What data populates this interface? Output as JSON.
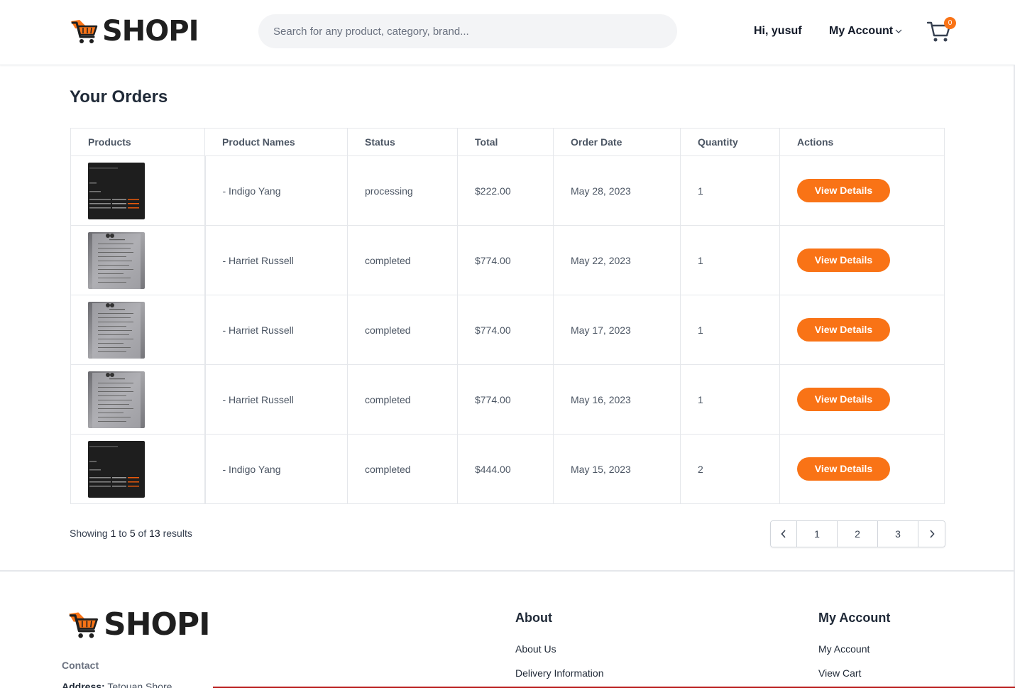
{
  "header": {
    "logo_text": "SHOPI",
    "search_placeholder": "Search for any product, category, brand...",
    "greeting": "Hi, yusuf",
    "account_label": "My Account",
    "cart_count": "0"
  },
  "page": {
    "title": "Your Orders"
  },
  "table": {
    "headers": [
      "Products",
      "Product Names",
      "Status",
      "Total",
      "Order Date",
      "Quantity",
      "Actions"
    ],
    "rows": [
      {
        "thumb": "code-screenshot",
        "name": "- Indigo Yang",
        "status": "processing",
        "total": "$222.00",
        "date": "May 28, 2023",
        "quantity": "1",
        "action": "View Details"
      },
      {
        "thumb": "paper-photo",
        "name": "- Harriet Russell",
        "status": "completed",
        "total": "$774.00",
        "date": "May 22, 2023",
        "quantity": "1",
        "action": "View Details"
      },
      {
        "thumb": "paper-photo",
        "name": "- Harriet Russell",
        "status": "completed",
        "total": "$774.00",
        "date": "May 17, 2023",
        "quantity": "1",
        "action": "View Details"
      },
      {
        "thumb": "paper-photo",
        "name": "- Harriet Russell",
        "status": "completed",
        "total": "$774.00",
        "date": "May 16, 2023",
        "quantity": "1",
        "action": "View Details"
      },
      {
        "thumb": "code-screenshot",
        "name": "- Indigo Yang",
        "status": "completed",
        "total": "$444.00",
        "date": "May 15, 2023",
        "quantity": "2",
        "action": "View Details"
      }
    ]
  },
  "pagination": {
    "showing_prefix": "Showing",
    "from": "1",
    "to_word": "to",
    "to": "5",
    "of_word": "of",
    "total": "13",
    "suffix": "results",
    "pages": [
      "1",
      "2",
      "3"
    ],
    "prev_icon": "chevron-left-icon",
    "next_icon": "chevron-right-icon"
  },
  "footer": {
    "logo_text": "SHOPI",
    "contact_title": "Contact",
    "address_label": "Address:",
    "address_value": "Tetouan Shore",
    "about_title": "About",
    "about_links": [
      "About Us",
      "Delivery Information"
    ],
    "account_title": "My Account",
    "account_links": [
      "My Account",
      "View Cart"
    ]
  },
  "colors": {
    "accent": "#f97316",
    "text": "#1f2937",
    "muted": "#4b5563",
    "border": "#e5e7eb"
  }
}
